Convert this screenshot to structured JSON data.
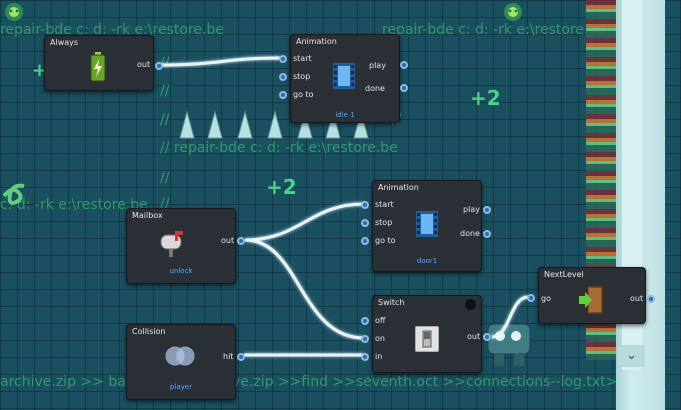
{
  "background": {
    "texts": [
      "repair-bde c: d: -rk e:\\restore.be",
      "repair-bde c: d: -rk e:\\restore.be",
      "//  repair-bde c: d: -rk e:\\restore.be",
      "c: d: -rk e:\\restore.be",
      "archive.zip >> bac",
      "ve.zip >>find >>seventh.oct >>connections--log.txt>>>",
      "//",
      "//",
      "//",
      "//",
      "//",
      "//"
    ],
    "plus_labels": [
      "+2",
      "+2",
      "+"
    ]
  },
  "nodes": {
    "always": {
      "title": "Always",
      "out": "out"
    },
    "animation1": {
      "title": "Animation",
      "inputs": [
        "start",
        "stop",
        "go to"
      ],
      "outputs": [
        "play",
        "done"
      ],
      "sub": "idle 1"
    },
    "animation2": {
      "title": "Animation",
      "inputs": [
        "start",
        "stop",
        "go to"
      ],
      "outputs": [
        "play",
        "done"
      ],
      "sub": "door1"
    },
    "mailbox": {
      "title": "Mailbox",
      "out": "out",
      "sub": "unlock"
    },
    "switch": {
      "title": "Switch",
      "inputs": [
        "off",
        "on",
        "in"
      ],
      "out": "out"
    },
    "collision": {
      "title": "Collision",
      "out": "hit",
      "sub": "player"
    },
    "nextlevel": {
      "title": "NextLevel",
      "in": "go",
      "out": "out"
    }
  },
  "scrollbar": {
    "down_glyph": "⌄"
  },
  "colors": {
    "wire": "#eaf6ff",
    "wire_glow": "#5fb8ff",
    "port": "#2c6fb1",
    "node_bg": "#2b2f36",
    "sub_label": "#52a8ff"
  }
}
